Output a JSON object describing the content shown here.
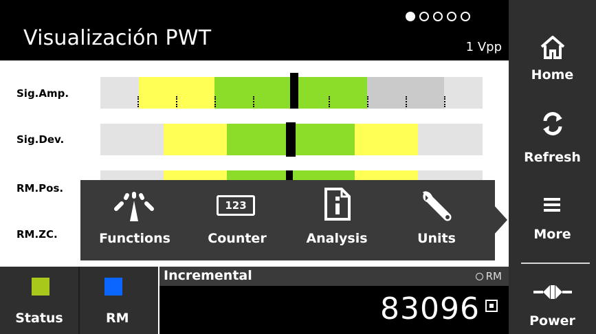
{
  "header": {
    "title": "Visualización PWT",
    "signal_type": "1 Vpp",
    "page_dots": {
      "total": 5,
      "active": 1
    }
  },
  "sidebar": {
    "home_label": "Home",
    "refresh_label": "Refresh",
    "more_label": "More",
    "power_label": "Power"
  },
  "signals": [
    {
      "label": "Sig.Amp."
    },
    {
      "label": "Sig.Dev."
    },
    {
      "label": "RM.Pos."
    },
    {
      "label": "RM.ZC."
    }
  ],
  "menu": {
    "functions_label": "Functions",
    "counter_label": "Counter",
    "counter_icon_text": "123",
    "analysis_label": "Analysis",
    "units_label": "Units"
  },
  "status": {
    "status_label": "Status",
    "rm_label": "RM",
    "status_color": "#a8c81c",
    "rm_color": "#0a66ff"
  },
  "incremental": {
    "title": "Incremental",
    "rm_indicator": "RM",
    "value": "83096"
  },
  "colors": {
    "yellow": "#ffff55",
    "green": "#8cdc2a",
    "gray_light": "#e3e3e3",
    "gray_mid": "#cacaca"
  }
}
